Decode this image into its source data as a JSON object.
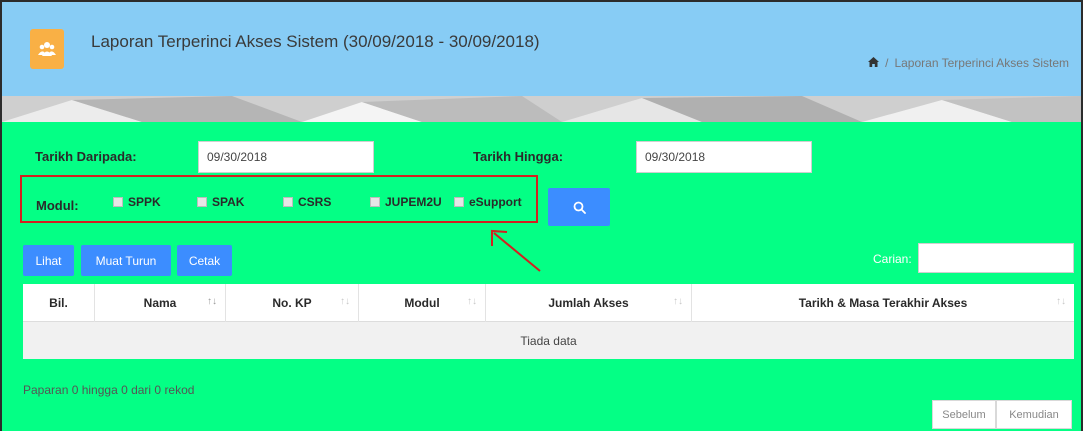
{
  "header": {
    "title": "Laporan Terperinci Akses Sistem (30/09/2018 - 30/09/2018)",
    "app_icon": "users-icon",
    "breadcrumb": {
      "home_icon": "home-icon",
      "separator": "/",
      "current": "Laporan Terperinci Akses Sistem"
    }
  },
  "filters": {
    "from_label": "Tarikh Daripada:",
    "from_value": "09/30/2018",
    "to_label": "Tarikh Hingga:",
    "to_value": "09/30/2018",
    "modul_label": "Modul:",
    "modules": [
      "SPPK",
      "SPAK",
      "CSRS",
      "JUPEM2U",
      "eSupport"
    ],
    "search_icon": "search-icon"
  },
  "toolbar": {
    "lihat": "Lihat",
    "muat_turun": "Muat Turun",
    "cetak": "Cetak",
    "carian_label": "Carian:",
    "carian_value": ""
  },
  "table": {
    "columns": [
      "Bil.",
      "Nama",
      "No. KP",
      "Modul",
      "Jumlah Akses",
      "Tarikh & Masa Terakhir Akses"
    ],
    "empty_text": "Tiada data"
  },
  "footer": {
    "info": "Paparan 0 hingga 0 dari 0 rekod",
    "prev": "Sebelum",
    "next": "Kemudian"
  },
  "colors": {
    "header_bg": "#87ccf5",
    "content_bg": "#04ff85",
    "button_bg": "#3c8dff",
    "icon_bg": "#f9b045",
    "highlight": "#d32020"
  }
}
